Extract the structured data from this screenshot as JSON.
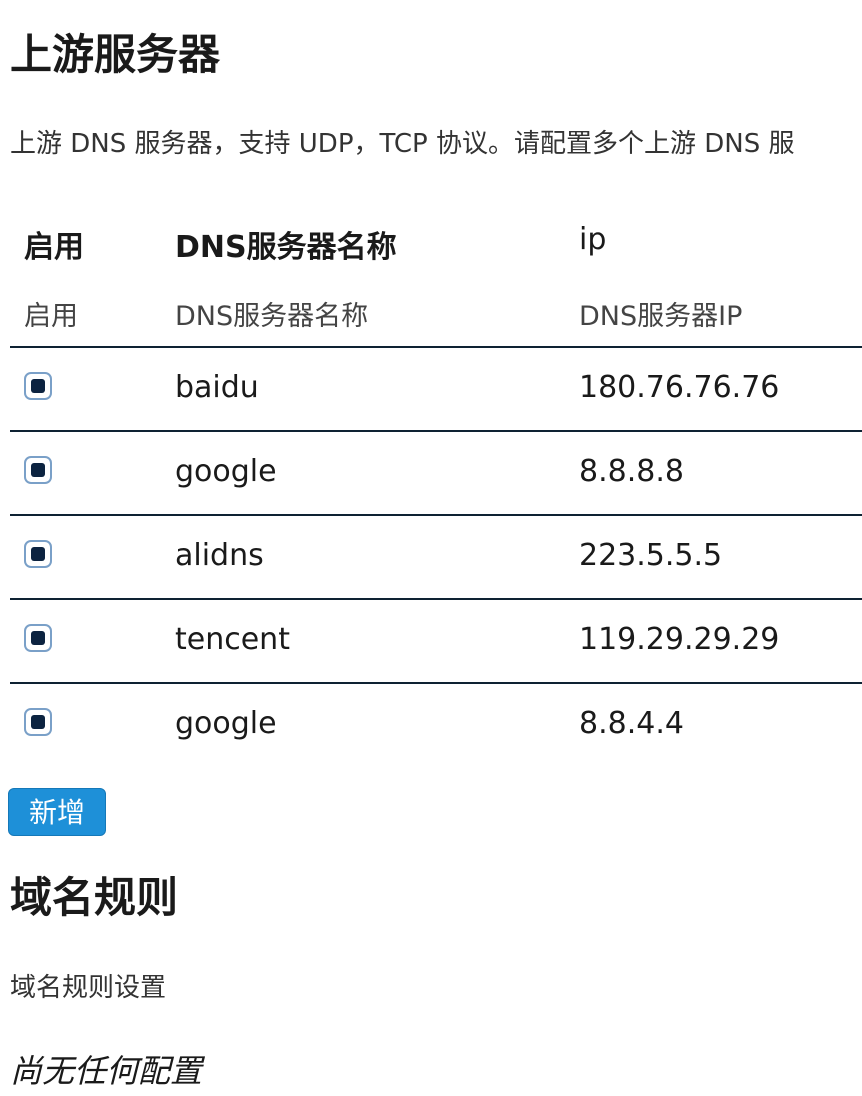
{
  "upstream": {
    "title": "上游服务器",
    "description": "上游 DNS 服务器，支持 UDP，TCP 协议。请配置多个上游 DNS 服",
    "table": {
      "headers": [
        "启用",
        "DNS服务器名称",
        "ip"
      ],
      "descriptions": [
        "启用",
        "DNS服务器名称",
        "DNS服务器IP"
      ],
      "rows": [
        {
          "enabled": true,
          "name": "baidu",
          "ip": "180.76.76.76"
        },
        {
          "enabled": true,
          "name": "google",
          "ip": "8.8.8.8"
        },
        {
          "enabled": true,
          "name": "alidns",
          "ip": "223.5.5.5"
        },
        {
          "enabled": true,
          "name": "tencent",
          "ip": "119.29.29.29"
        },
        {
          "enabled": true,
          "name": "google",
          "ip": "8.8.4.4"
        }
      ]
    },
    "add_label": "新增"
  },
  "domain_rules": {
    "title": "域名规则",
    "description": "域名规则设置",
    "empty_text": "尚无任何配置"
  },
  "colors": {
    "accent": "#1e90d8",
    "checkbox_fill": "#0c2340",
    "row_border": "#0e2233"
  }
}
